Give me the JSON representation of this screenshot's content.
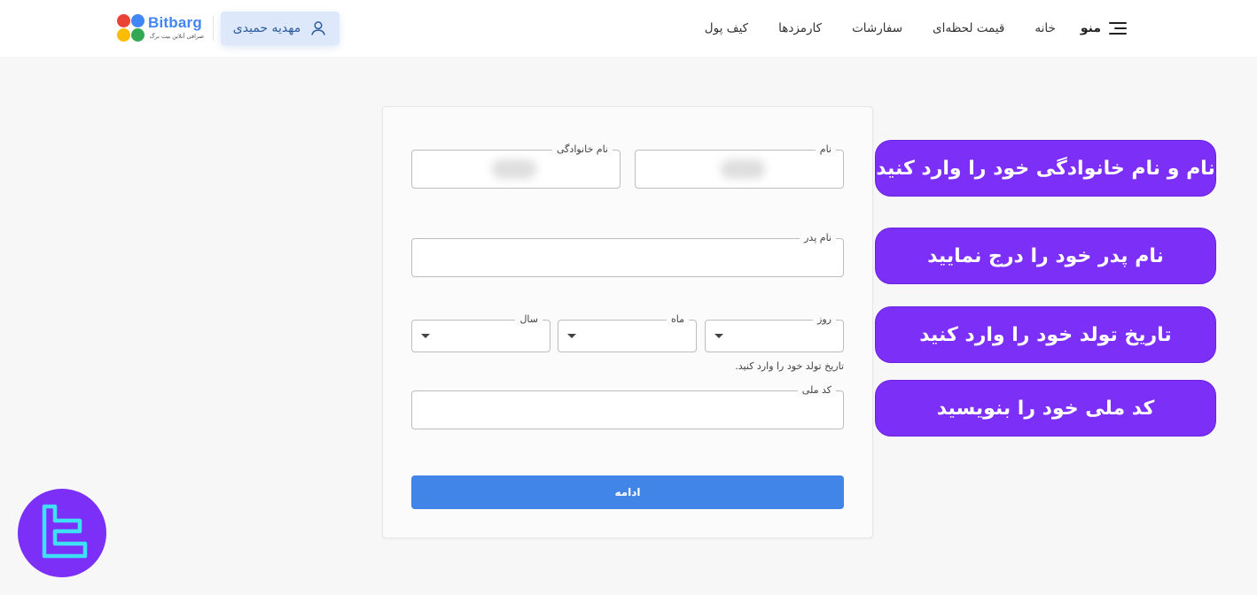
{
  "header": {
    "brand": "Bitbarg",
    "tagline": "صرافی آنلاین بیت برگ",
    "user_name": "مهدیه حمیدی",
    "menu_label": "منو",
    "nav": [
      "خانه",
      "قیمت لحظه‌ای",
      "سفارشات",
      "کارمزدها",
      "کیف پول"
    ]
  },
  "form": {
    "first_name_label": "نام",
    "last_name_label": "نام خانوادگی",
    "father_name_label": "نام پدر",
    "day_label": "روز",
    "month_label": "ماه",
    "year_label": "سال",
    "birth_hint": "تاریخ تولد خود را وارد کنید.",
    "national_code_label": "کد ملی",
    "submit_label": "ادامه"
  },
  "callouts": [
    "نام و نام خانوادگی خود را وارد کنید",
    "نام پدر خود را درج نمایید",
    "تاریخ تولد خود را وارد کنید",
    "کد ملی خود را بنویسید"
  ],
  "colors": {
    "accent": "#7b2ff7",
    "primary_button": "#4285e8",
    "user_button_bg": "#dde9fb"
  }
}
